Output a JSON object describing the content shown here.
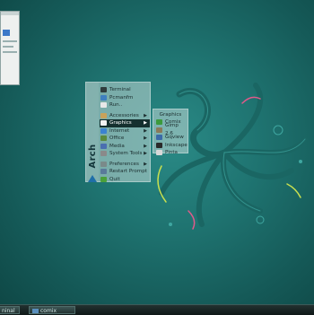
{
  "menu": {
    "brand": "Arch",
    "items": [
      {
        "label": "Terminal",
        "icon": "terminal-icon",
        "color": "#2f3b3c"
      },
      {
        "label": "Pcmanfm",
        "icon": "folder-icon",
        "color": "#3f7fbf"
      },
      {
        "label": "Run..",
        "icon": "run-icon",
        "color": "#e8e8e8"
      },
      {
        "label": "Accessories",
        "icon": "accessories-icon",
        "color": "#c8a25a"
      },
      {
        "label": "Graphics",
        "icon": "graphics-icon",
        "color": "#f2f2f2"
      },
      {
        "label": "Internet",
        "icon": "globe-icon",
        "color": "#3b82d0"
      },
      {
        "label": "Office",
        "icon": "office-icon",
        "color": "#5a8a3c"
      },
      {
        "label": "Media",
        "icon": "media-icon",
        "color": "#4a6fb0"
      },
      {
        "label": "System Tools",
        "icon": "system-tools-icon",
        "color": "#8a8a8a"
      },
      {
        "label": "Preferences",
        "icon": "preferences-icon",
        "color": "#7a8a8a"
      },
      {
        "label": "Restart Prompt",
        "icon": "restart-icon",
        "color": "#5a7a9a"
      },
      {
        "label": "Quit",
        "icon": "quit-icon",
        "color": "#4aa03a"
      }
    ]
  },
  "submenu": {
    "title": "Graphics",
    "items": [
      {
        "label": "Comix",
        "icon": "comix-icon",
        "color": "#3c9a3c"
      },
      {
        "label": "Gimp 2.6",
        "icon": "gimp-icon",
        "color": "#8a7a5a"
      },
      {
        "label": "Gqview",
        "icon": "gqview-icon",
        "color": "#3a6aa8"
      },
      {
        "label": "Inkscape",
        "icon": "inkscape-icon",
        "color": "#2a2a2a"
      },
      {
        "label": "Pinta",
        "icon": "pinta-icon",
        "color": "#d8d8d8"
      }
    ]
  },
  "taskbar": {
    "items": [
      {
        "label": "ninal"
      },
      {
        "label": "comix"
      }
    ]
  }
}
